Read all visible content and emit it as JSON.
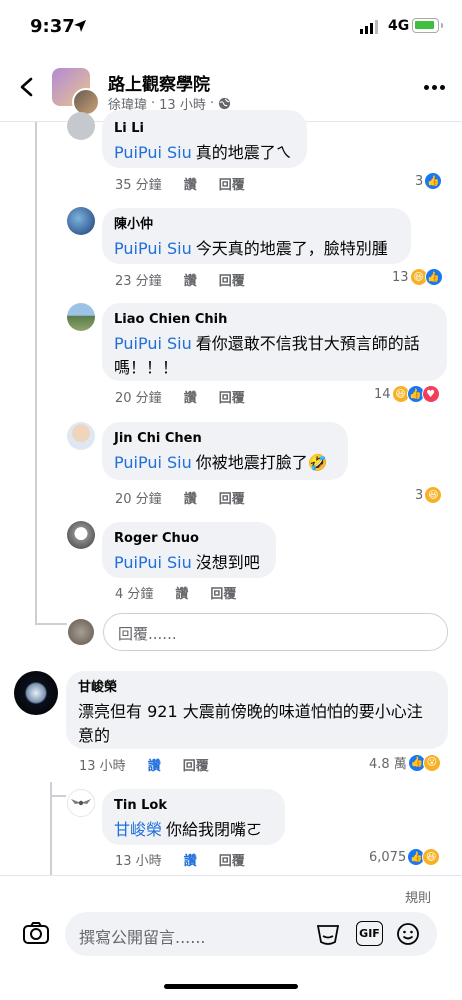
{
  "status_bar": {
    "time": "9:37",
    "network": "4G"
  },
  "header": {
    "group_name": "路上觀察學院",
    "author": "徐瑋瑋",
    "time": "13 小時",
    "privacy_icon": "globe-icon"
  },
  "comments": [
    {
      "name": "Li Li",
      "mention": "PuiPui Siu",
      "text": "真的地震了ㄟ",
      "time": "35 分鐘",
      "like_label": "讚",
      "reply_label": "回覆",
      "reaction_count": "3",
      "reactions": [
        "like"
      ]
    },
    {
      "name": "陳小仲",
      "mention": "PuiPui Siu",
      "text": "今天真的地震了，臉特別腫",
      "time": "23 分鐘",
      "like_label": "讚",
      "reply_label": "回覆",
      "reaction_count": "13",
      "reactions": [
        "haha",
        "like"
      ]
    },
    {
      "name": "Liao Chien Chih",
      "mention": "PuiPui Siu",
      "text": "看你還敢不信我甘大預言師的話",
      "text2": "嗎！！！",
      "time": "20 分鐘",
      "like_label": "讚",
      "reply_label": "回覆",
      "reaction_count": "14",
      "reactions": [
        "haha",
        "like",
        "love"
      ]
    },
    {
      "name": "Jin Chi Chen",
      "mention": "PuiPui Siu",
      "text": "你被地震打臉了🤣",
      "time": "20 分鐘",
      "like_label": "讚",
      "reply_label": "回覆",
      "reaction_count": "3",
      "reactions": [
        "haha"
      ]
    },
    {
      "name": "Roger Chuo",
      "mention": "PuiPui Siu",
      "text": "沒想到吧",
      "time": "4 分鐘",
      "like_label": "讚",
      "reply_label": "回覆"
    }
  ],
  "reply_input": {
    "placeholder": "回覆......"
  },
  "top_comment": {
    "name": "甘峻榮",
    "text": "漂亮但有 921 大震前傍晚的味道怕怕的要小心注",
    "text2": "意的",
    "time": "13 小時",
    "like_label": "讚",
    "reply_label": "回覆",
    "reaction_count": "4.8 萬",
    "reactions": [
      "like",
      "wow"
    ]
  },
  "nested_reply": {
    "name": "Tin Lok",
    "mention": "甘峻榮",
    "text": "你給我閉嘴ㄛ",
    "time": "13 小時",
    "like_label": "讚",
    "reply_label": "回覆",
    "reaction_count": "6,075",
    "reactions": [
      "like",
      "haha"
    ]
  },
  "bottom_bar": {
    "rules_label": "規則",
    "comment_placeholder": "撰寫公開留言......",
    "gif_label": "GIF"
  },
  "colors": {
    "accent": "#1877f2",
    "mention": "#216fdb",
    "bubble": "#f0f2f5"
  }
}
